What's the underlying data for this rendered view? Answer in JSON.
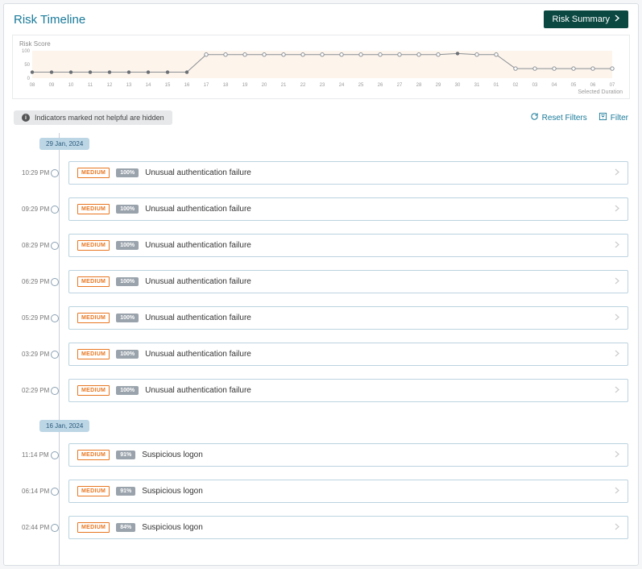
{
  "header": {
    "title": "Risk Timeline",
    "risk_summary_label": "Risk Summary"
  },
  "chart_data": {
    "type": "line",
    "title": "Risk Score",
    "xlabel": "",
    "ylabel": "",
    "ylim": [
      0,
      100
    ],
    "yticks": [
      0,
      50,
      100
    ],
    "categories": [
      "08",
      "09",
      "10",
      "11",
      "12",
      "13",
      "14",
      "15",
      "16",
      "17",
      "18",
      "19",
      "20",
      "21",
      "22",
      "23",
      "24",
      "25",
      "26",
      "27",
      "28",
      "29",
      "30",
      "31",
      "01",
      "02",
      "03",
      "04",
      "05",
      "06",
      "07"
    ],
    "values": [
      22,
      22,
      22,
      22,
      22,
      22,
      22,
      22,
      22,
      86,
      86,
      86,
      86,
      86,
      86,
      86,
      86,
      86,
      86,
      86,
      86,
      86,
      90,
      86,
      86,
      35,
      35,
      35,
      35,
      35,
      35
    ],
    "caption": "Selected Duration"
  },
  "toolbar": {
    "notice": "Indicators marked not helpful are hidden",
    "reset_label": "Reset Filters",
    "filter_label": "Filter"
  },
  "severity_label": "MEDIUM",
  "dates": [
    {
      "label": "29 Jan, 2024",
      "events": [
        {
          "time": "10:29 PM",
          "pct": "100%",
          "title": "Unusual authentication failure"
        },
        {
          "time": "09:29 PM",
          "pct": "100%",
          "title": "Unusual authentication failure"
        },
        {
          "time": "08:29 PM",
          "pct": "100%",
          "title": "Unusual authentication failure"
        },
        {
          "time": "06:29 PM",
          "pct": "100%",
          "title": "Unusual authentication failure"
        },
        {
          "time": "05:29 PM",
          "pct": "100%",
          "title": "Unusual authentication failure"
        },
        {
          "time": "03:29 PM",
          "pct": "100%",
          "title": "Unusual authentication failure"
        },
        {
          "time": "02:29 PM",
          "pct": "100%",
          "title": "Unusual authentication failure"
        }
      ]
    },
    {
      "label": "16 Jan, 2024",
      "events": [
        {
          "time": "11:14 PM",
          "pct": "91%",
          "title": "Suspicious logon"
        },
        {
          "time": "06:14 PM",
          "pct": "91%",
          "title": "Suspicious logon"
        },
        {
          "time": "02:44 PM",
          "pct": "84%",
          "title": "Suspicious logon"
        }
      ]
    }
  ]
}
